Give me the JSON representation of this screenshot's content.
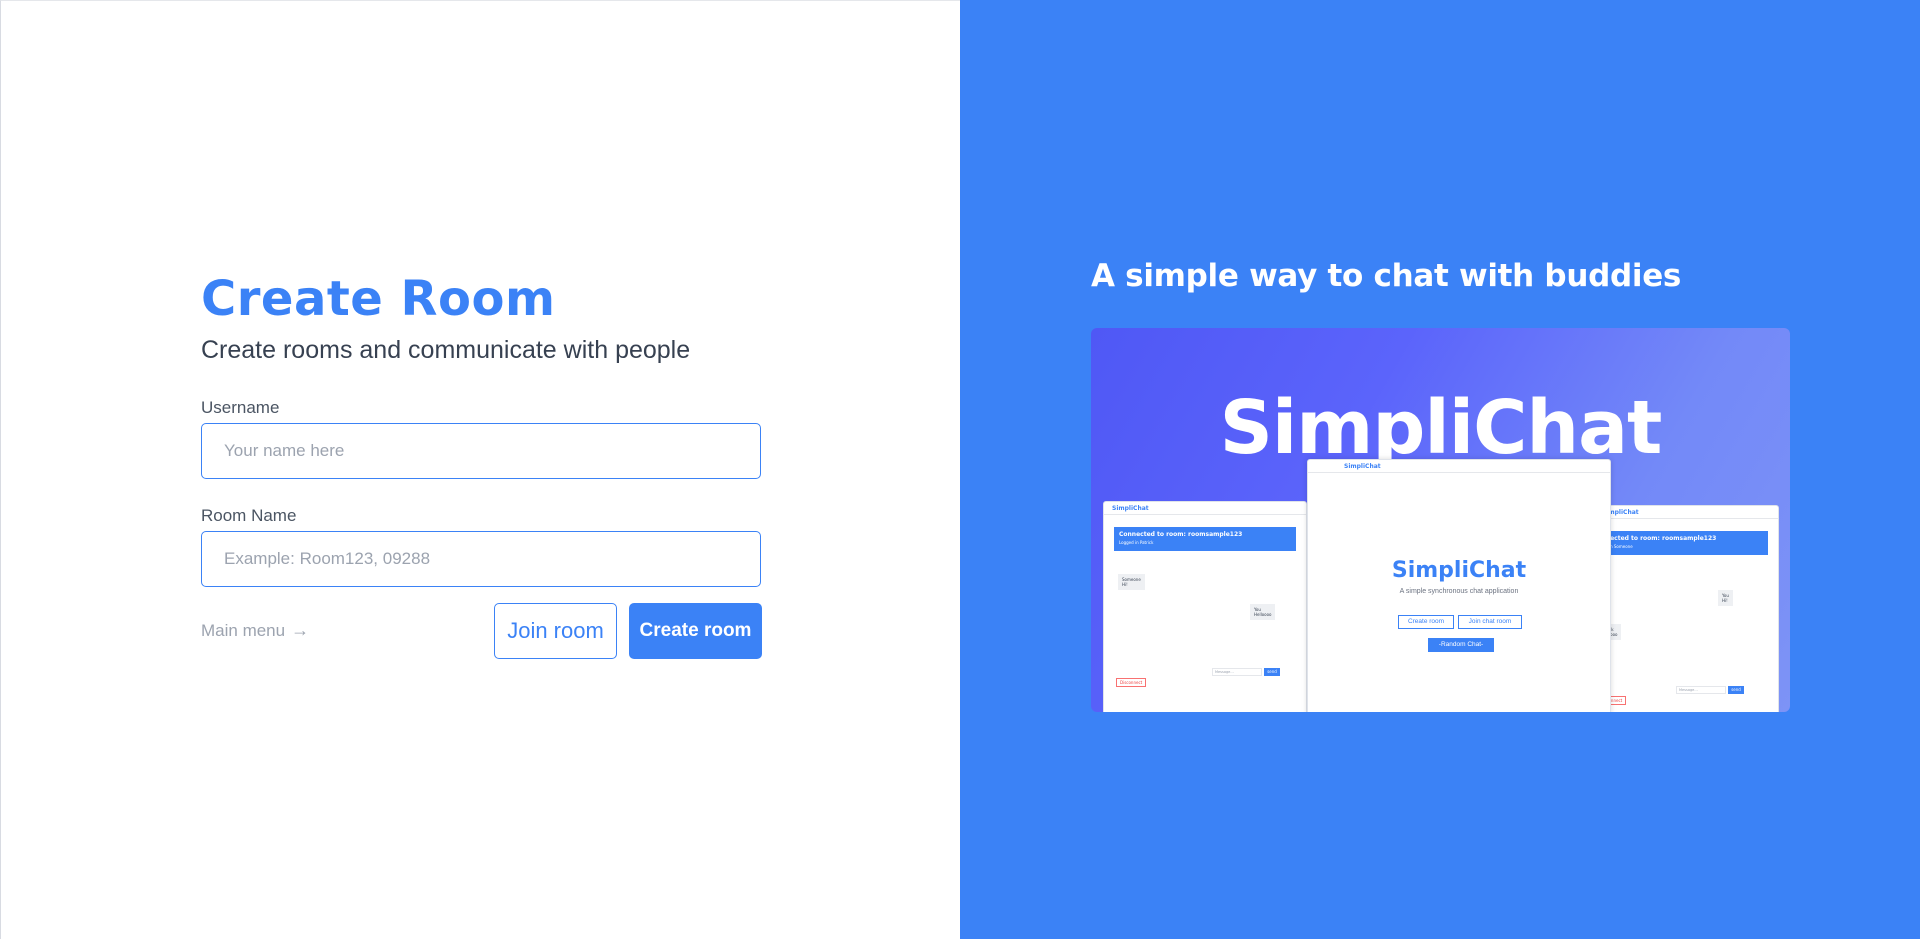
{
  "form": {
    "title": "Create Room",
    "subtitle": "Create rooms and communicate with people",
    "username_label": "Username",
    "username_placeholder": "Your name here",
    "username_value": "",
    "room_label": "Room Name",
    "room_placeholder": "Example: Room123, 09288",
    "room_value": "",
    "main_menu_label": "Main menu",
    "join_label": "Join room",
    "create_label": "Create room"
  },
  "promo": {
    "tagline": "A simple way to chat with buddies",
    "brand": "SimpliChat",
    "preview": {
      "left_window": {
        "bar": "SimpliChat",
        "connected": "Connected to room: roomsample123",
        "logged": "Logged in Patrick",
        "bubble_a_name": "Someone",
        "bubble_a_text": "Hi!",
        "bubble_b_name": "You",
        "bubble_b_text": "Helloooo",
        "input": "Message...",
        "send": "send",
        "disconnect": "Disconnect"
      },
      "center_window": {
        "bar": "SimpliChat",
        "brand": "SimpliChat",
        "sub": "A simple synchronous chat application",
        "create": "Create room",
        "join": "Join chat room",
        "random": "-Random Chat-"
      },
      "right_window": {
        "bar": "SimpliChat",
        "connected": "Connected to room: roomsample123",
        "logged": "Logged in Someone",
        "bubble_a_name": "You",
        "bubble_a_text": "Hi!",
        "bubble_b_name": "Patrick",
        "bubble_b_text": "Helloooo",
        "input": "Message...",
        "send": "send",
        "disconnect": "Disconnect"
      }
    }
  },
  "colors": {
    "accent": "#3b82f6",
    "panel": "#3b82f6",
    "muted": "#9ca3af"
  },
  "icons": {
    "main_menu": "arrow-right-icon"
  }
}
